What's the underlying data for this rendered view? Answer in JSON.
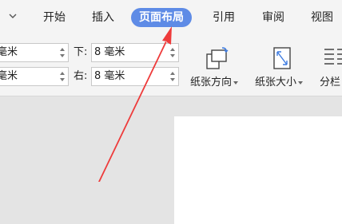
{
  "tabs": {
    "start": "开始",
    "insert": "插入",
    "page_layout": "页面布局",
    "reference": "引用",
    "review": "审阅",
    "view": "视图"
  },
  "margins": {
    "left_top_value": "毫米",
    "left_bottom_value": "毫米",
    "bottom_label": "下:",
    "bottom_value": "8 毫米",
    "right_label": "右:",
    "right_value": "8 毫米"
  },
  "buttons": {
    "orientation": "纸张方向",
    "size": "纸张大小",
    "columns": "分栏"
  },
  "colors": {
    "accent": "#5e8be6",
    "annotation_arrow": "#ee3b3b"
  },
  "icons": {
    "collapse": "chevron-down-icon",
    "orientation": "page-orientation-icon",
    "size": "paper-size-icon",
    "columns": "columns-icon"
  }
}
